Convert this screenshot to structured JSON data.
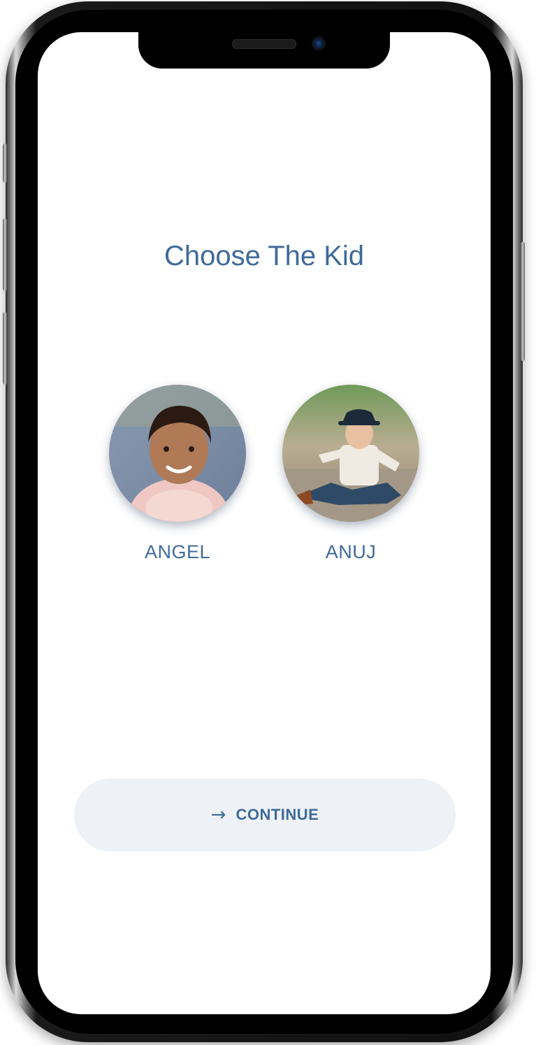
{
  "screen": {
    "title": "Choose The Kid"
  },
  "kids": [
    {
      "name": "ANGEL",
      "selected": true
    },
    {
      "name": "ANUJ",
      "selected": false
    }
  ],
  "actions": {
    "continue_label": "CONTINUE",
    "continue_icon": "arrow-right-icon"
  },
  "colors": {
    "accent": "#3f6a9a",
    "button_bg": "#eef2f6",
    "screen_bg": "#ffffff"
  }
}
